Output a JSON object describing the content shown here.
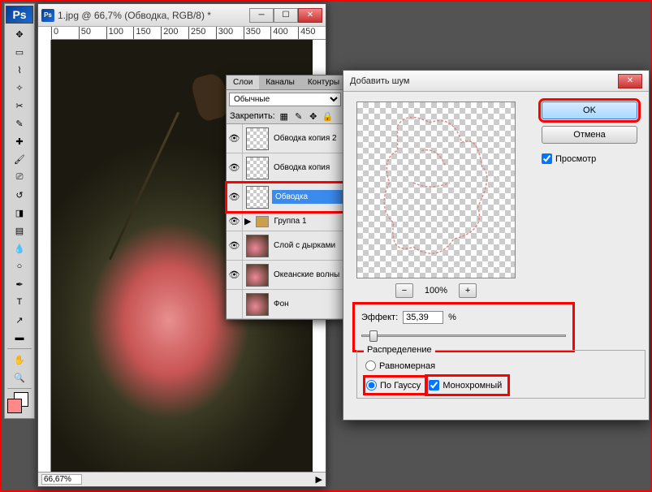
{
  "toolbar": {
    "logo": "Ps",
    "tools": [
      "move",
      "marquee",
      "lasso",
      "wand",
      "crop",
      "eyedrop",
      "heal",
      "brush",
      "stamp",
      "history",
      "eraser",
      "gradient",
      "blur",
      "dodge",
      "pen",
      "type",
      "path",
      "shape",
      "hand",
      "zoom"
    ]
  },
  "document": {
    "title": "1.jpg @ 66,7% (Обводка, RGB/8) *",
    "ruler_marks": [
      "0",
      "50",
      "100",
      "150",
      "200",
      "250",
      "300",
      "350",
      "400",
      "450"
    ],
    "zoom": "66,67%"
  },
  "layers_panel": {
    "tabs": [
      "Слои",
      "Каналы",
      "Контуры"
    ],
    "blend_mode": "Обычные",
    "lock_label": "Закрепить:",
    "items": [
      {
        "name": "Обводка копия 2",
        "thumb": "trans"
      },
      {
        "name": "Обводка копия",
        "thumb": "trans"
      },
      {
        "name": "Обводка",
        "thumb": "trans",
        "selected": true
      },
      {
        "name": "Группа 1",
        "thumb": "grp",
        "grp": true
      },
      {
        "name": "Слой с дырками",
        "thumb": "pic"
      },
      {
        "name": "Океанские волны",
        "thumb": "pic"
      },
      {
        "name": "Фон",
        "thumb": "pic"
      }
    ]
  },
  "dialog": {
    "title": "Добавить шум",
    "ok": "OK",
    "cancel": "Отмена",
    "preview_label": "Просмотр",
    "preview_checked": true,
    "zoom_value": "100%",
    "effect_label": "Эффект:",
    "effect_value": "35,39",
    "effect_unit": "%",
    "distribution_label": "Распределение",
    "dist_uniform": "Равномерная",
    "dist_gaussian": "По Гауссу",
    "dist_selected": "gaussian",
    "mono_label": "Монохромный",
    "mono_checked": true
  }
}
